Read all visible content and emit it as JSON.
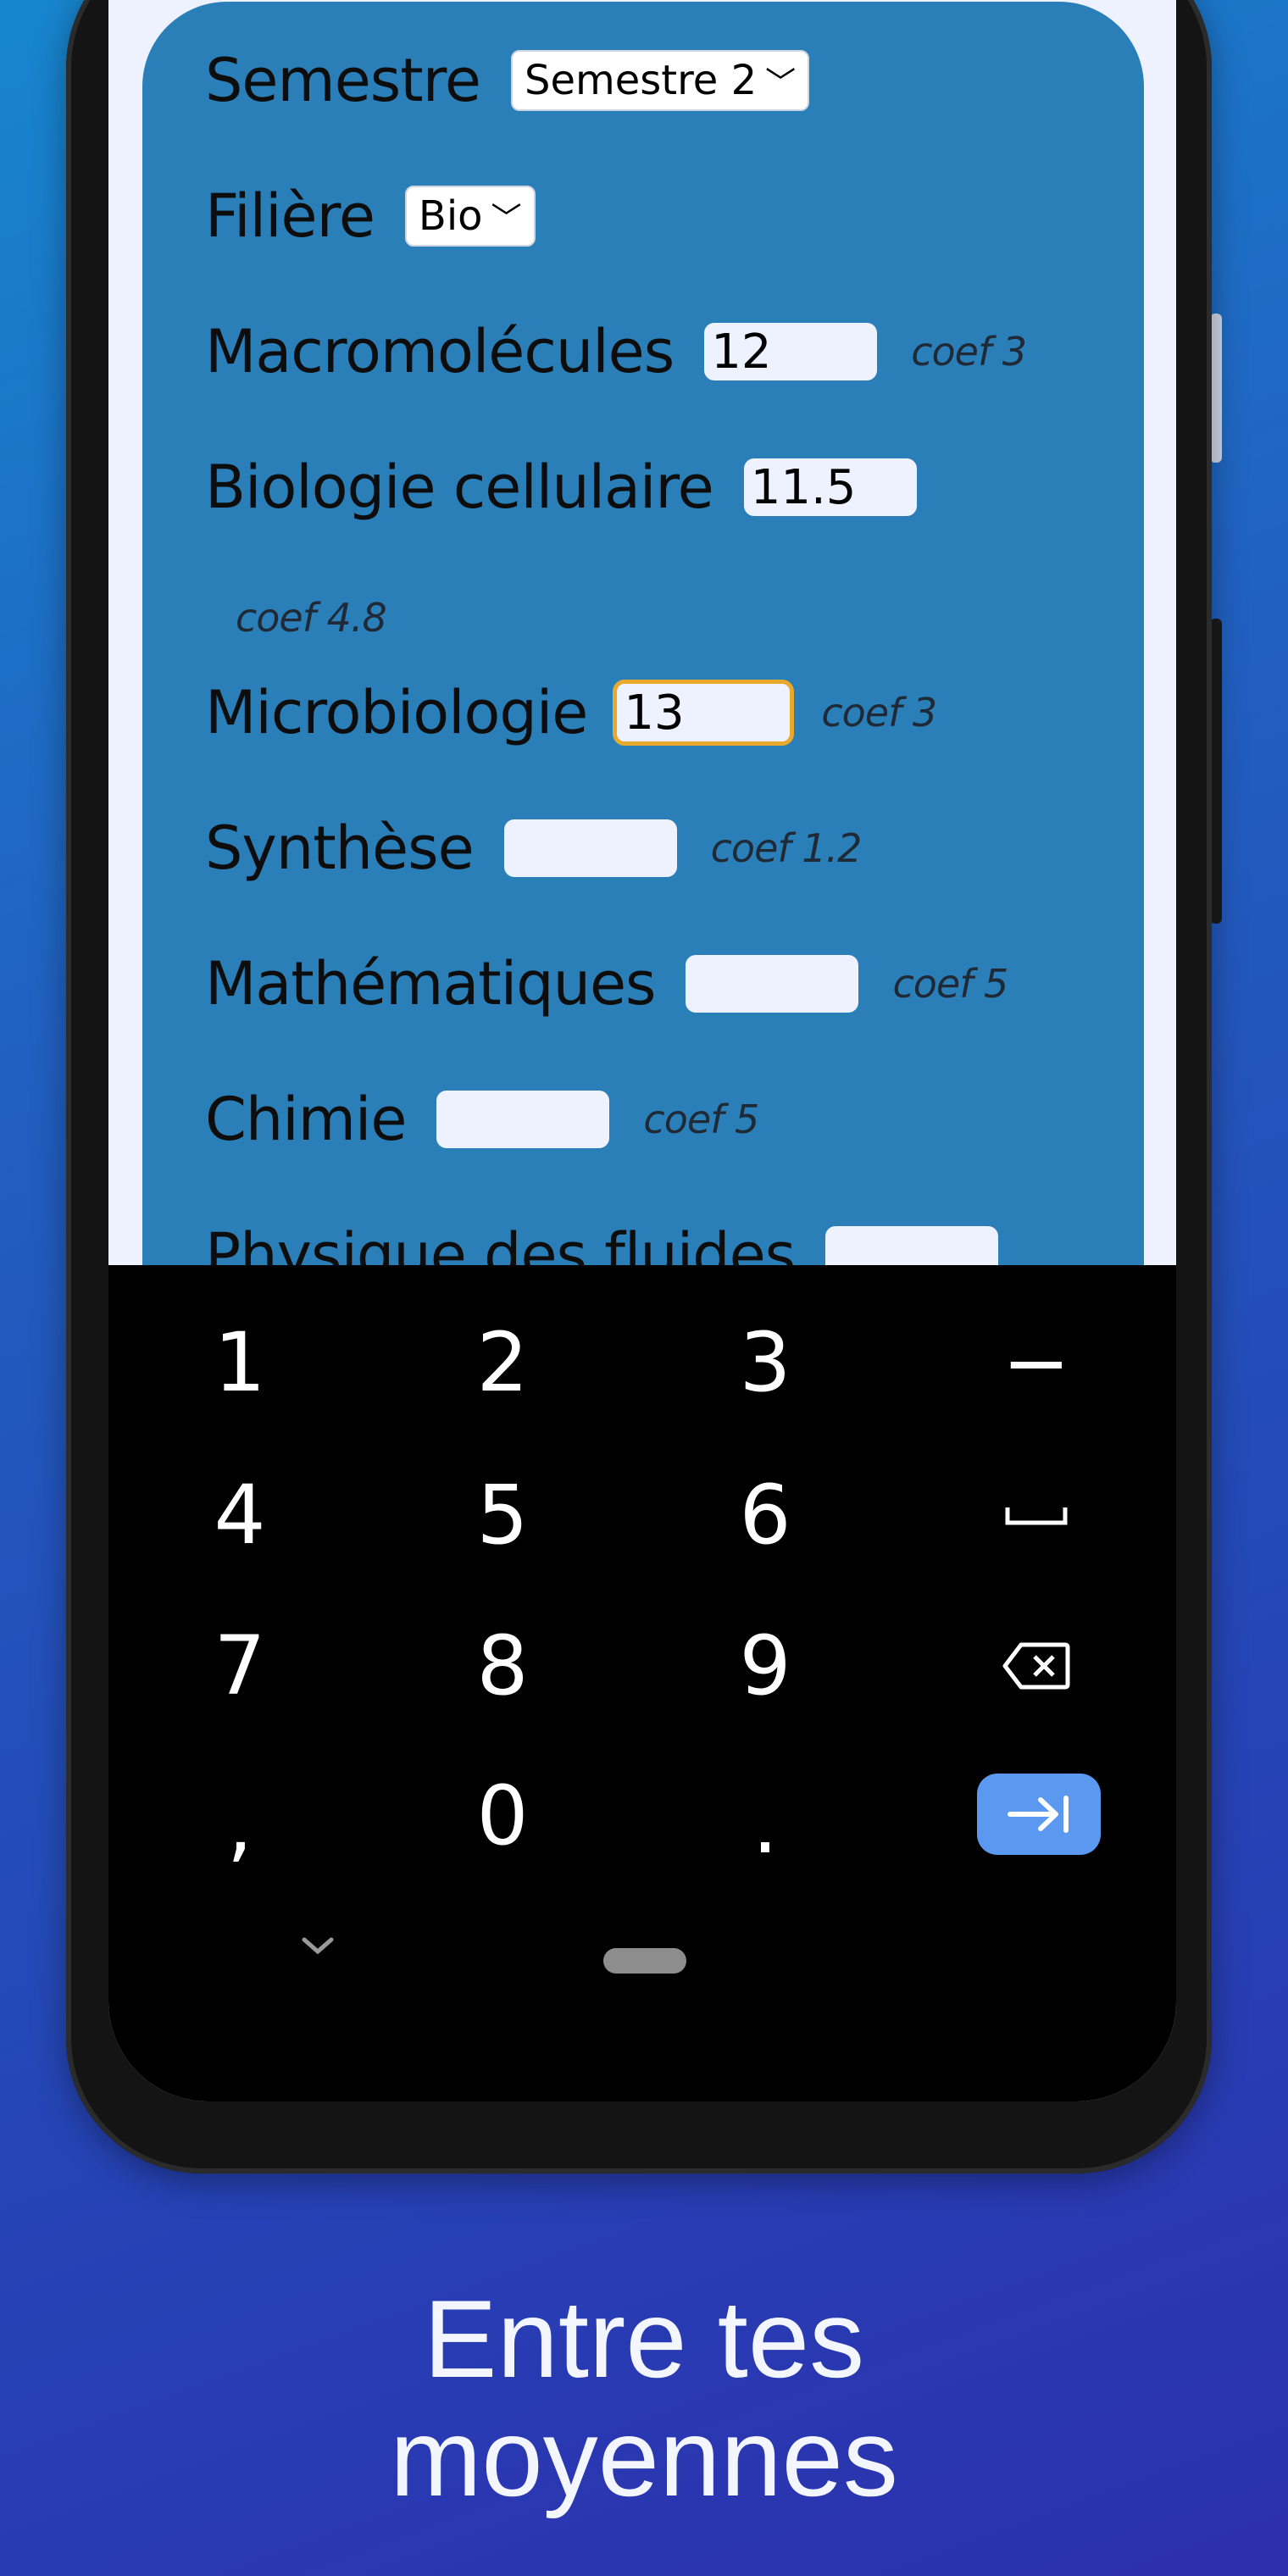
{
  "form": {
    "semester_label": "Semestre",
    "semester_value": "Semestre 2",
    "filiere_label": "Filière",
    "filiere_value": "Bio",
    "subjects": [
      {
        "label": "Macromolécules",
        "value": "12",
        "coef": "coef 3"
      },
      {
        "label": "Biologie cellulaire",
        "value": "11.5",
        "coef": "coef 4.8"
      },
      {
        "label": "Microbiologie",
        "value": "13",
        "coef": "coef 3",
        "focused": true
      },
      {
        "label": "Synthèse",
        "value": "",
        "coef": "coef 1.2"
      },
      {
        "label": "Mathématiques",
        "value": "",
        "coef": "coef 5"
      },
      {
        "label": "Chimie",
        "value": "",
        "coef": "coef 5"
      },
      {
        "label": "Physique des fluides",
        "value": ""
      }
    ]
  },
  "keyboard": {
    "keys": [
      "1",
      "2",
      "3",
      "−",
      "4",
      "5",
      "6",
      "␣",
      "7",
      "8",
      "9",
      "⌫",
      ",",
      "0",
      "."
    ],
    "enter_icon": "tab-arrow-icon",
    "backspace_icon": "backspace-icon",
    "space_icon": "space-icon"
  },
  "tagline": {
    "line1": "Entre tes",
    "line2": "moyennes"
  },
  "colors": {
    "background_top": "#1786cf",
    "background_bottom": "#2c2fae",
    "panel": "#2b7fb8",
    "input_bg": "#eef2ff",
    "focus_border": "#e8a92c",
    "enter_key": "#5b98f0"
  }
}
